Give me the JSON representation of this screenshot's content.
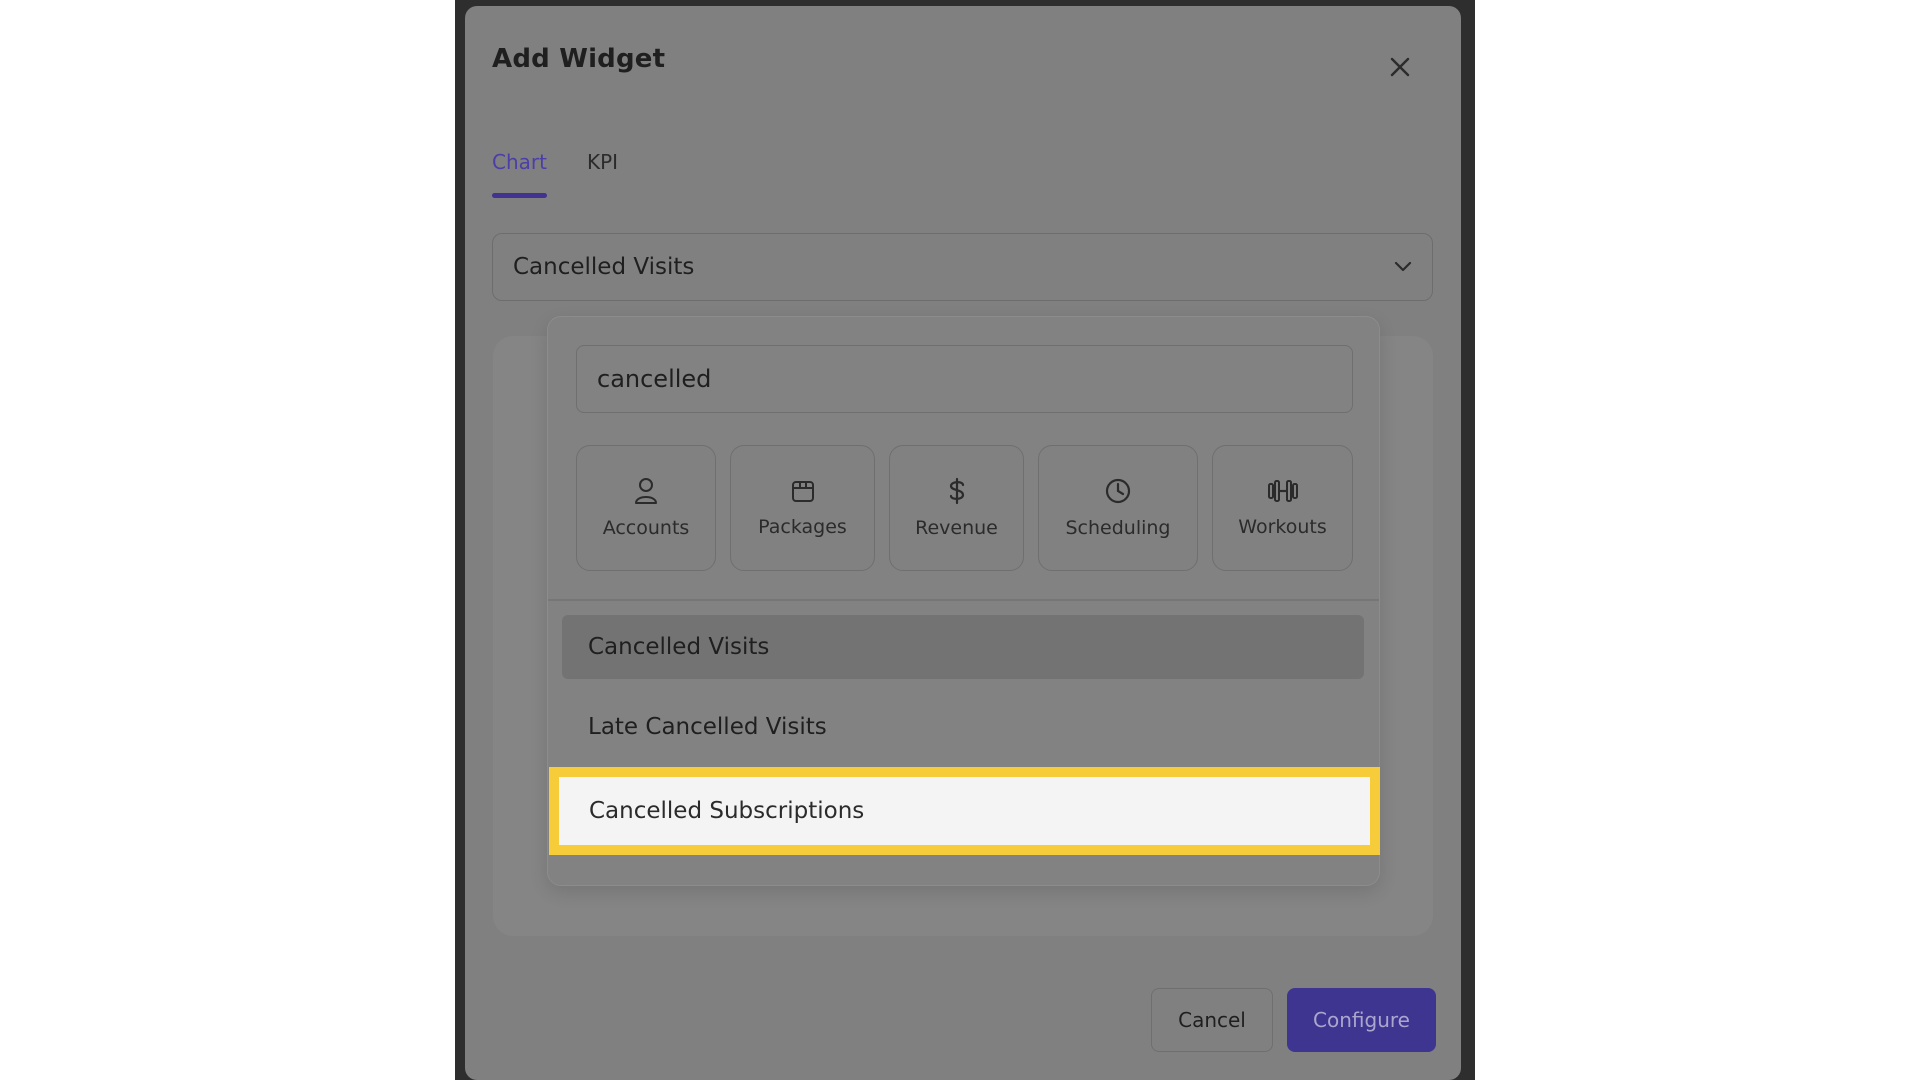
{
  "dialog": {
    "title": "Add Widget",
    "tabs": [
      {
        "label": "Chart",
        "active": true
      },
      {
        "label": "KPI",
        "active": false
      }
    ],
    "select": {
      "value": "Cancelled Visits",
      "icon": "chevron-down-icon"
    },
    "search": {
      "value": "cancelled"
    },
    "categories": [
      {
        "label": "Accounts",
        "icon": "person-icon"
      },
      {
        "label": "Packages",
        "icon": "package-icon"
      },
      {
        "label": "Revenue",
        "icon": "dollar-icon"
      },
      {
        "label": "Scheduling",
        "icon": "clock-icon"
      },
      {
        "label": "Workouts",
        "icon": "dumbbell-icon"
      }
    ],
    "options": [
      {
        "label": "Cancelled Visits"
      },
      {
        "label": "Late Cancelled Visits"
      },
      {
        "label": "Cancelled Subscriptions"
      }
    ],
    "buttons": {
      "cancel": "Cancel",
      "configure": "Configure"
    }
  },
  "colors": {
    "accent": "#41338f",
    "highlight": "#f6cc3b"
  }
}
